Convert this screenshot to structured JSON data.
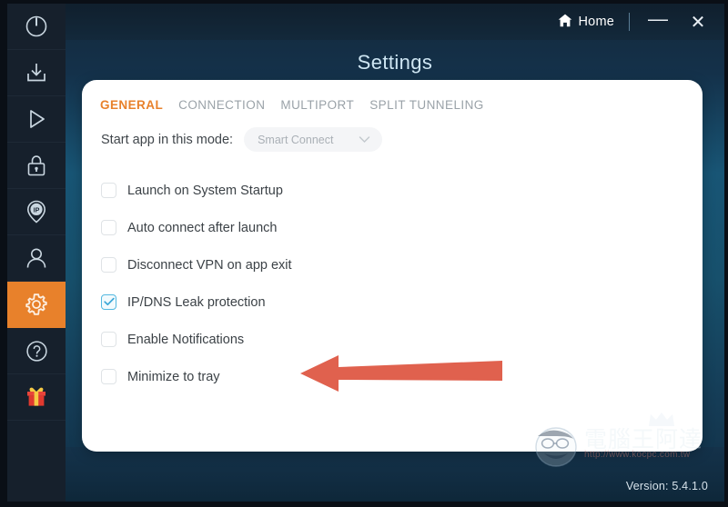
{
  "sidebar": {
    "items": [
      {
        "name": "power",
        "icon": "power-icon",
        "active": false
      },
      {
        "name": "download",
        "icon": "download-icon",
        "active": false
      },
      {
        "name": "play",
        "icon": "play-icon",
        "active": false
      },
      {
        "name": "lock",
        "icon": "lock-icon",
        "active": false
      },
      {
        "name": "ip",
        "icon": "ip-pin-icon",
        "label": "IP",
        "active": false
      },
      {
        "name": "account",
        "icon": "user-icon",
        "active": false
      },
      {
        "name": "settings",
        "icon": "gear-icon",
        "active": true
      },
      {
        "name": "help",
        "icon": "question-icon",
        "active": false
      },
      {
        "name": "gift",
        "icon": "gift-icon",
        "active": false
      }
    ],
    "active_color": "#e8812b"
  },
  "titlebar": {
    "home_label": "Home",
    "home_icon": "home-icon",
    "minimize_label": "—",
    "close_label": "✕"
  },
  "header": {
    "title": "Settings"
  },
  "tabs": [
    {
      "label": "GENERAL",
      "active": true
    },
    {
      "label": "CONNECTION",
      "active": false
    },
    {
      "label": "MULTIPORT",
      "active": false
    },
    {
      "label": "SPLIT TUNNELING",
      "active": false
    }
  ],
  "mode": {
    "label": "Start app in this mode:",
    "value": "Smart Connect",
    "chevron": "∨"
  },
  "options": [
    {
      "label": "Launch on System Startup",
      "checked": false
    },
    {
      "label": "Auto connect after launch",
      "checked": false
    },
    {
      "label": "Disconnect VPN on app exit",
      "checked": false
    },
    {
      "label": "IP/DNS Leak protection",
      "checked": true
    },
    {
      "label": "Enable Notifications",
      "checked": false
    },
    {
      "label": "Minimize to tray",
      "checked": false
    }
  ],
  "footer": {
    "version": "Version: 5.4.1.0"
  },
  "watermark": {
    "text": "電腦王阿達",
    "url": "http://www.kocpc.com.tw"
  },
  "annotation": {
    "arrow_color": "#e0614e",
    "direction": "left"
  },
  "colors": {
    "accent": "#e8812b",
    "check": "#53b8e0",
    "card_bg": "#ffffff",
    "window_top": "#13293b",
    "window_mid": "#185575"
  }
}
